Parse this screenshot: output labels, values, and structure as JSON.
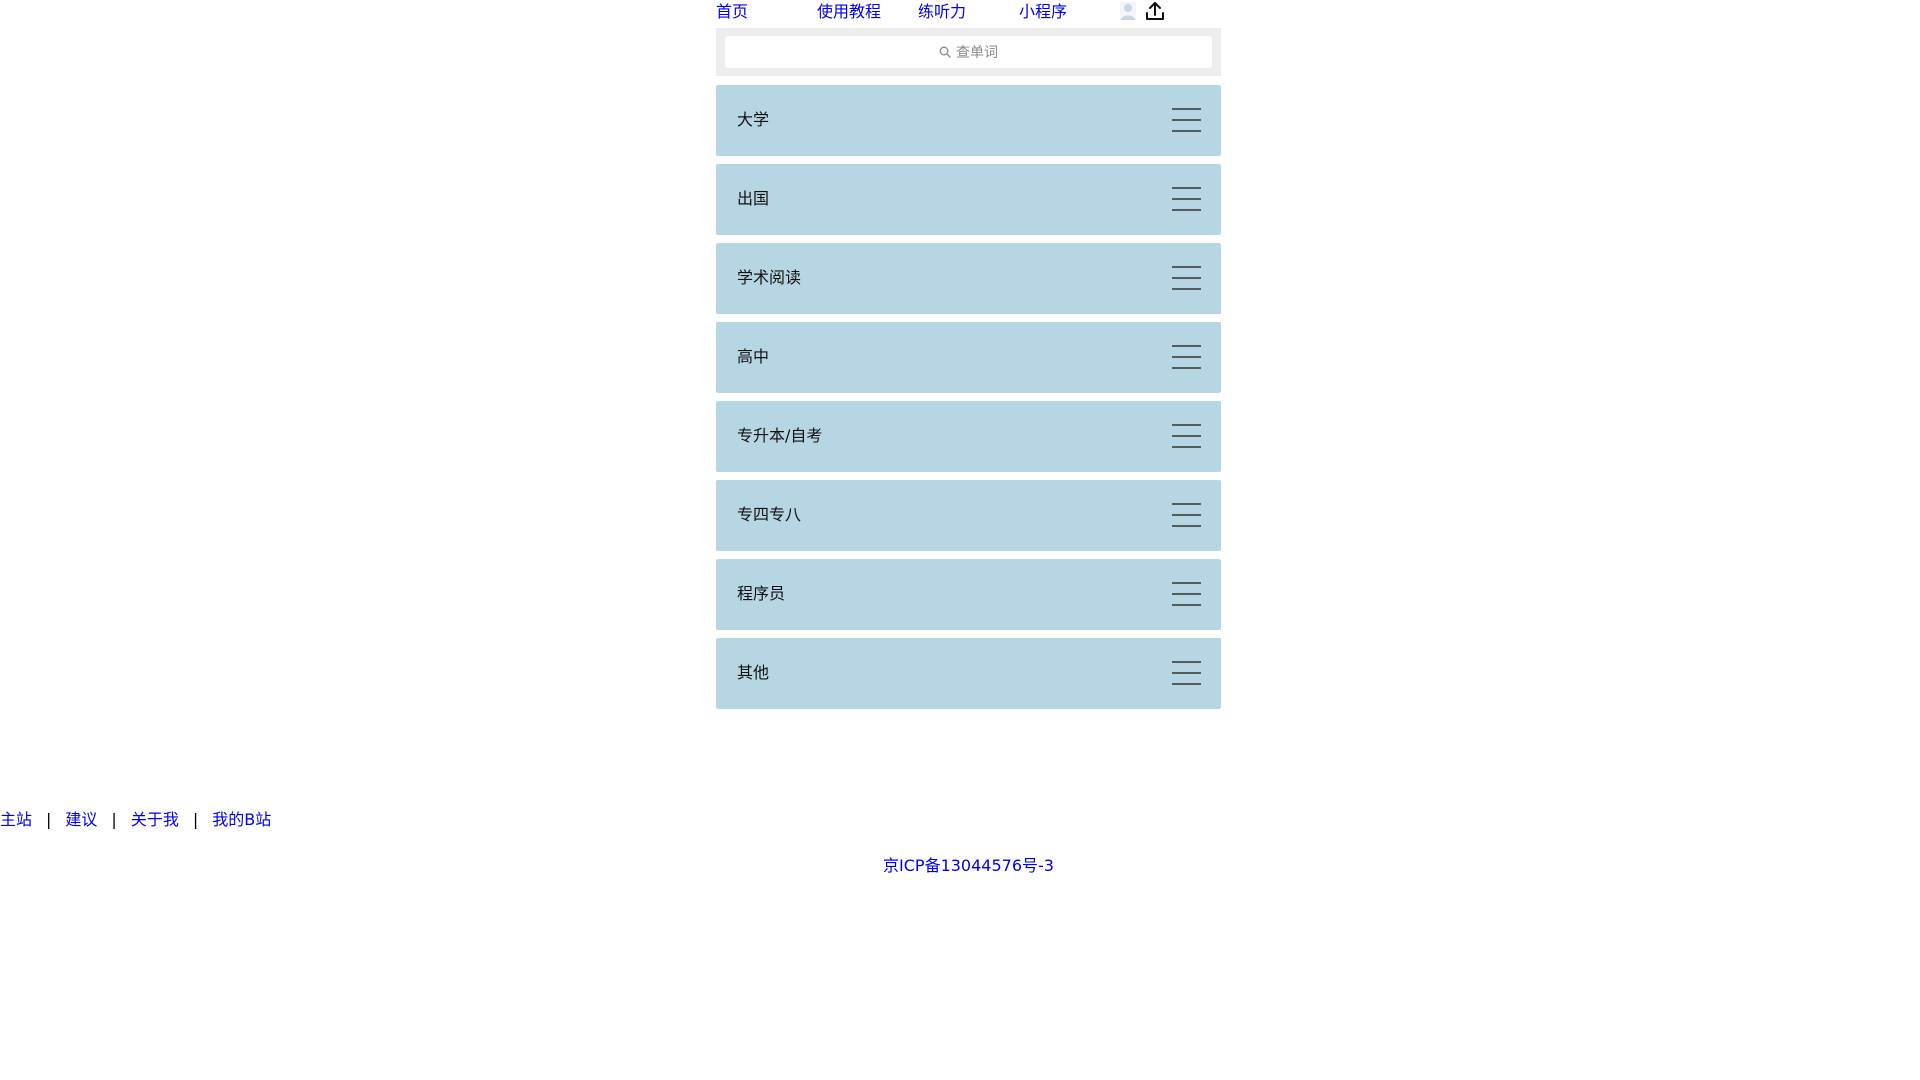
{
  "nav": {
    "items": [
      "首页",
      "使用教程",
      "练听力",
      "小程序"
    ]
  },
  "search": {
    "placeholder": "查单词"
  },
  "categories": [
    "大学",
    "出国",
    "学术阅读",
    "高中",
    "专升本/自考",
    "专四专八",
    "程序员",
    "其他"
  ],
  "footer": {
    "links": [
      "主站",
      "建议",
      "关于我",
      "我的B站"
    ],
    "separator": "|",
    "icp": "京ICP备13044576号-3"
  },
  "colors": {
    "link": "#0000ee",
    "category_bg": "#b6d6e3",
    "search_bg": "#ededed"
  },
  "icons": {
    "avatar": "user-avatar-icon",
    "upload": "upload-icon",
    "search": "search-icon",
    "menu": "hamburger-menu-icon"
  }
}
